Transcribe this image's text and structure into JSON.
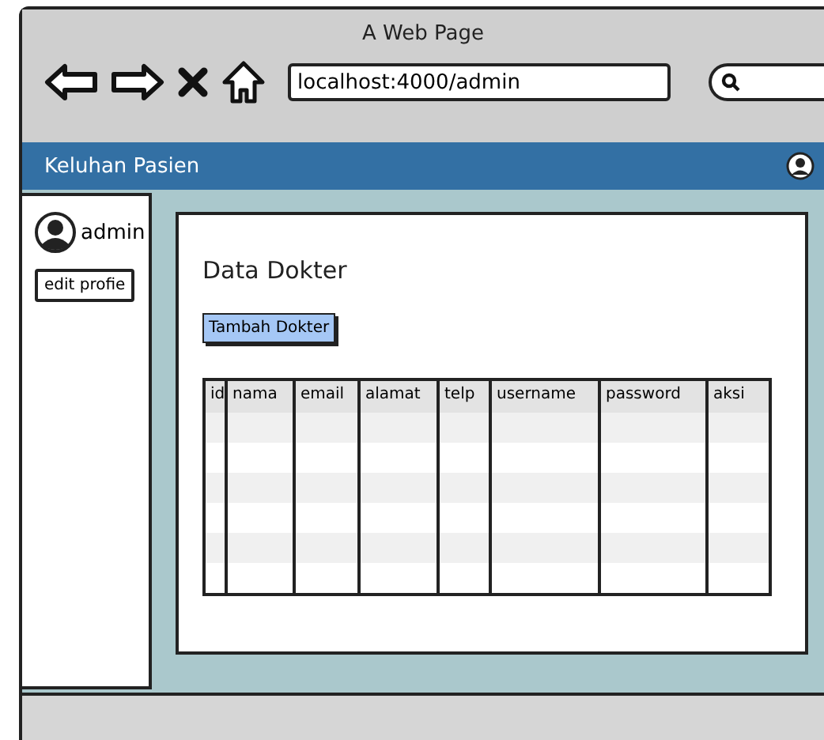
{
  "window": {
    "title": "A Web Page"
  },
  "address_bar": {
    "value": "localhost:4000/admin"
  },
  "navbar": {
    "title": "Keluhan Pasien"
  },
  "sidebar": {
    "user": "admin",
    "button": "edit profie"
  },
  "main": {
    "heading": "Data Dokter",
    "add_button": "Tambah Dokter"
  },
  "table": {
    "columns": [
      "id",
      "nama",
      "email",
      "alamat",
      "telp",
      "username",
      "password",
      "aksi"
    ]
  }
}
